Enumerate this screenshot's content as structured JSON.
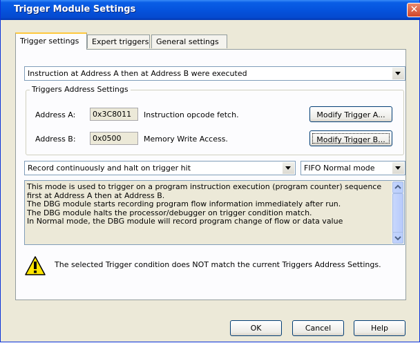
{
  "window": {
    "title": "Trigger Module Settings",
    "close_glyph": "✕"
  },
  "tabs": [
    {
      "label": "Trigger settings",
      "active": true
    },
    {
      "label": "Expert triggers",
      "active": false
    },
    {
      "label": "General settings",
      "active": false
    }
  ],
  "trigger_type": {
    "value": "Instruction at Address A then at Address B were executed"
  },
  "address_group": {
    "title": "Triggers Address Settings",
    "address_a": {
      "label": "Address A:",
      "value": "0x3C8011",
      "description": "Instruction opcode fetch.",
      "button": "Modify Trigger A..."
    },
    "address_b": {
      "label": "Address B:",
      "value": "0x0500",
      "description": "Memory Write Access.",
      "button": "Modify Trigger B..."
    }
  },
  "record_mode": {
    "value": "Record continuously and halt on trigger hit"
  },
  "fifo_mode": {
    "value": "FIFO Normal mode"
  },
  "description_lines": [
    "This mode is used to trigger on a program instruction execution (program counter) sequence",
    "first at Address A then at Address B.",
    "The DBG module starts recording program flow information immediately after run.",
    "The DBG module halts the processor/debugger on trigger condition match.",
    "In Normal mode, the DBG module will record program change of flow or data value"
  ],
  "warning": {
    "icon": "warning-icon",
    "text": "The selected Trigger condition does NOT match the current Triggers Address Settings."
  },
  "footer": {
    "ok": "OK",
    "cancel": "Cancel",
    "help": "Help"
  },
  "colors": {
    "title_bar": "#0553dd",
    "dialog_bg": "#ece9d8",
    "tab_highlight": "#ffc83c"
  }
}
